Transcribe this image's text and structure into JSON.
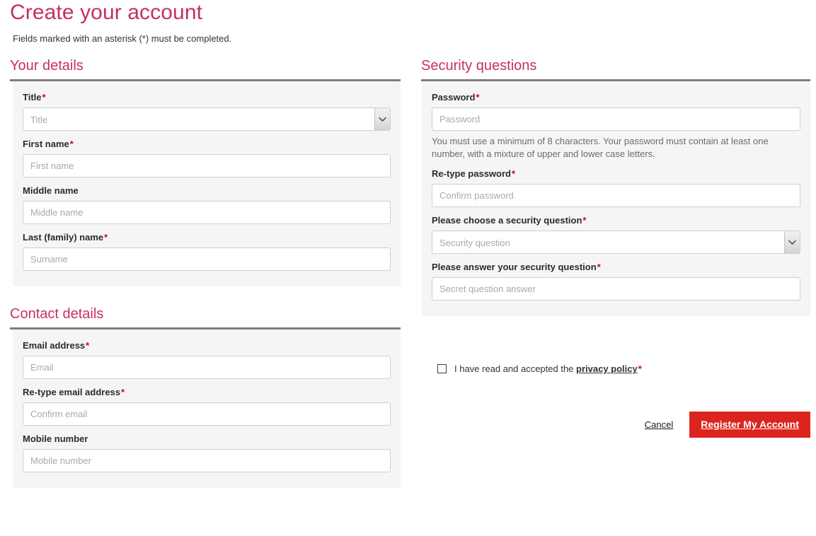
{
  "header": {
    "title": "Create your account",
    "subtitle": "Fields marked with an asterisk (*) must be completed."
  },
  "required_marker": "*",
  "colors": {
    "heading": "#c5315e",
    "required": "#d0021b",
    "primary_button": "#dc241f",
    "panel_background": "#f5f5f5",
    "rule": "#7d7d7d"
  },
  "sections": {
    "your_details": {
      "heading": "Your details",
      "fields": [
        {
          "label": "Title",
          "required": true,
          "type": "select",
          "placeholder": "Title"
        },
        {
          "label": "First name",
          "required": true,
          "type": "text",
          "placeholder": "First name"
        },
        {
          "label": "Middle name",
          "required": false,
          "type": "text",
          "placeholder": "Middle name"
        },
        {
          "label": "Last (family) name",
          "required": true,
          "type": "text",
          "placeholder": "Surname"
        }
      ]
    },
    "contact_details": {
      "heading": "Contact details",
      "fields": [
        {
          "label": "Email address",
          "required": true,
          "type": "text",
          "placeholder": "Email"
        },
        {
          "label": "Re-type email address",
          "required": true,
          "type": "text",
          "placeholder": "Confirm email"
        },
        {
          "label": "Mobile number",
          "required": false,
          "type": "text",
          "placeholder": "Mobile number"
        }
      ]
    },
    "security_questions": {
      "heading": "Security questions",
      "fields": [
        {
          "label": "Password",
          "required": true,
          "type": "password",
          "placeholder": "Password"
        },
        {
          "label": "Re-type password",
          "required": true,
          "type": "password",
          "placeholder": "Confirm password"
        },
        {
          "label": "Please choose a security question",
          "required": true,
          "type": "select",
          "placeholder": "Security question"
        },
        {
          "label": "Please answer your security question",
          "required": true,
          "type": "text",
          "placeholder": "Secret question answer"
        }
      ],
      "password_help": "You must use a minimum of 8 characters. Your password must contain at least one number, with a mixture of upper and lower case letters."
    }
  },
  "consent": {
    "text_before_link": "I have read and accepted the",
    "link_label": "privacy policy",
    "checked": false
  },
  "actions": {
    "cancel_label": "Cancel",
    "submit_label": "Register My Account"
  },
  "icons": {
    "select_chevron": "chevron-down-icon"
  }
}
